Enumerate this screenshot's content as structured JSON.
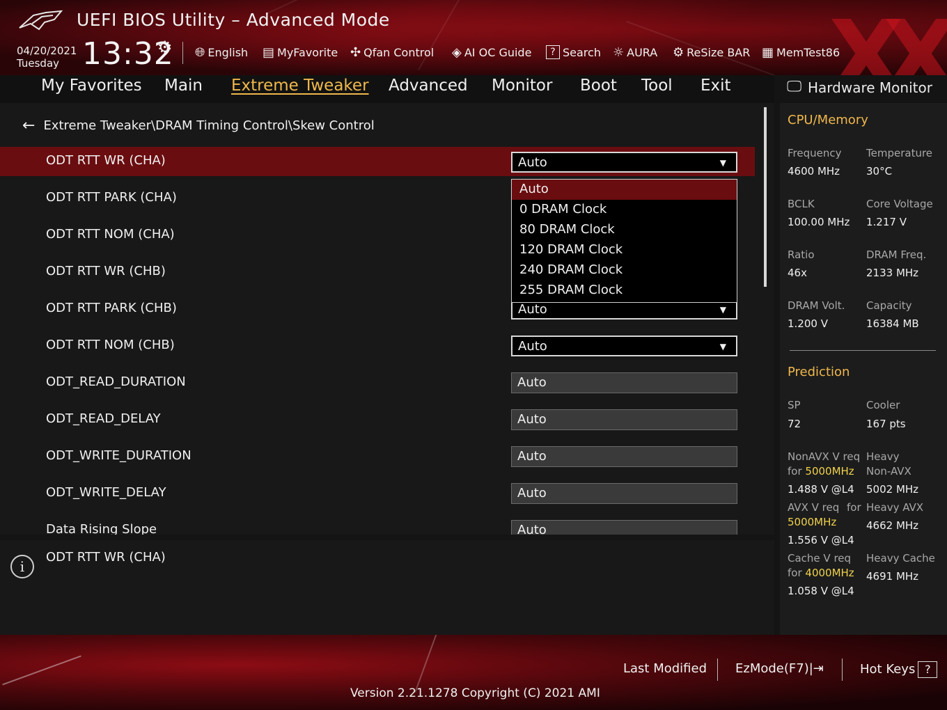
{
  "header": {
    "app_title": "UEFI BIOS Utility – Advanced Mode",
    "date": "04/20/2021",
    "day": "Tuesday",
    "time": "13:32",
    "toolbar": [
      {
        "label": "English",
        "icon": "globe-icon"
      },
      {
        "label": "MyFavorite",
        "icon": "favorite-icon"
      },
      {
        "label": "Qfan Control",
        "icon": "fan-icon"
      },
      {
        "label": "AI OC Guide",
        "icon": "ai-icon"
      },
      {
        "label": "Search",
        "icon": "search-icon"
      },
      {
        "label": "AURA",
        "icon": "aura-icon"
      },
      {
        "label": "ReSize BAR",
        "icon": "resize-bar-icon"
      },
      {
        "label": "MemTest86",
        "icon": "memtest-icon"
      }
    ]
  },
  "nav": {
    "tabs": [
      {
        "label": "My Favorites"
      },
      {
        "label": "Main"
      },
      {
        "label": "Extreme Tweaker"
      },
      {
        "label": "Advanced"
      },
      {
        "label": "Monitor"
      },
      {
        "label": "Boot"
      },
      {
        "label": "Tool"
      },
      {
        "label": "Exit"
      }
    ],
    "active": "Extreme Tweaker"
  },
  "main": {
    "breadcrumb": "Extreme Tweaker\\DRAM Timing Control\\Skew Control",
    "rows": [
      {
        "label": "ODT RTT WR (CHA)",
        "value": "Auto"
      },
      {
        "label": "ODT RTT PARK (CHA)",
        "value": ""
      },
      {
        "label": "ODT RTT NOM (CHA)",
        "value": ""
      },
      {
        "label": "ODT RTT WR (CHB)",
        "value": ""
      },
      {
        "label": "ODT RTT PARK (CHB)",
        "value": "Auto"
      },
      {
        "label": "ODT RTT NOM (CHB)",
        "value": "Auto"
      },
      {
        "label": "ODT_READ_DURATION",
        "value": "Auto"
      },
      {
        "label": "ODT_READ_DELAY",
        "value": "Auto"
      },
      {
        "label": "ODT_WRITE_DURATION",
        "value": "Auto"
      },
      {
        "label": "ODT_WRITE_DELAY",
        "value": "Auto"
      },
      {
        "label": "Data Rising Slope",
        "value": "Auto"
      }
    ],
    "dropdown_options": [
      "Auto",
      "0 DRAM Clock",
      "80 DRAM Clock",
      "120 DRAM Clock",
      "240 DRAM Clock",
      "255 DRAM Clock"
    ],
    "dropdown_selected": "Auto"
  },
  "help": {
    "text": "ODT RTT WR (CHA)"
  },
  "monitor": {
    "title": "Hardware Monitor",
    "cpu_section": "CPU/Memory",
    "frequency_k": "Frequency",
    "frequency_v": "4600 MHz",
    "temperature_k": "Temperature",
    "temperature_v": "30°C",
    "bclk_k": "BCLK",
    "bclk_v": "100.00 MHz",
    "core_voltage_k": "Core Voltage",
    "core_voltage_v": "1.217 V",
    "ratio_k": "Ratio",
    "ratio_v": "46x",
    "dram_freq_k": "DRAM Freq.",
    "dram_freq_v": "2133 MHz",
    "dram_volt_k": "DRAM Volt.",
    "dram_volt_v": "1.200 V",
    "capacity_k": "Capacity",
    "capacity_v": "16384 MB",
    "prediction_section": "Prediction",
    "sp_k": "SP",
    "sp_v": "72",
    "cooler_k": "Cooler",
    "cooler_v": "167 pts",
    "nonavx_k1": "NonAVX V req",
    "nonavx_k2": "for ",
    "nonavx_freq": "5000MHz",
    "nonavx_v": "1.488 V @L4",
    "heavy_nonavx_k1": "Heavy",
    "heavy_nonavx_k2": "Non-AVX",
    "heavy_nonavx_v": "5002 MHz",
    "avx_k1": "AVX V req",
    "avx_k2": "for",
    "avx_freq": "5000MHz",
    "avx_v": "1.556 V @L4",
    "heavy_avx_k": "Heavy AVX",
    "heavy_avx_v": "4662 MHz",
    "cache_k1": "Cache V req",
    "cache_k2": "for ",
    "cache_freq": "4000MHz",
    "cache_v": "1.058 V @L4",
    "heavy_cache_k": "Heavy Cache",
    "heavy_cache_v": "4691 MHz"
  },
  "footer": {
    "last_modified": "Last Modified",
    "ezmode": "EzMode(F7)|",
    "hotkeys": "Hot Keys",
    "hotkeys_key": "?",
    "version": "Version 2.21.1278 Copyright (C) 2021 AMI"
  },
  "colors": {
    "accent": "#f0b84c",
    "selection": "#6a0d10",
    "highlight_freq": "#f0d24c"
  }
}
